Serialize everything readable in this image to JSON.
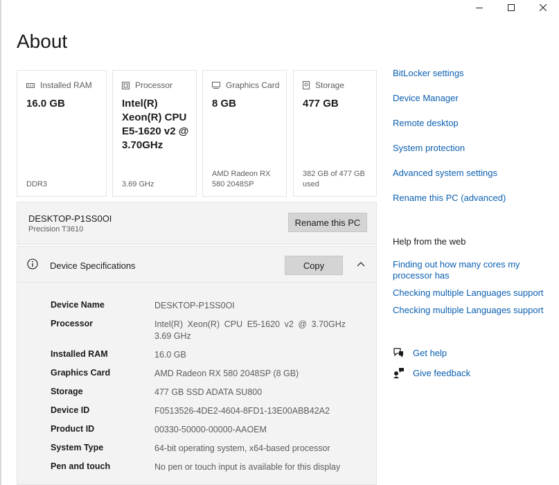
{
  "page": {
    "title": "About"
  },
  "window_controls": {
    "minimize_icon": "minimize-icon",
    "maximize_icon": "maximize-icon",
    "close_icon": "close-icon"
  },
  "cards": [
    {
      "label": "Installed RAM",
      "icon": "ram-icon",
      "value": "16.0 GB",
      "sub": "DDR3"
    },
    {
      "label": "Processor",
      "icon": "processor-icon",
      "value": "Intel(R) Xeon(R) CPU E5-1620 v2 @ 3.70GHz",
      "sub": "3.69 GHz"
    },
    {
      "label": "Graphics Card",
      "icon": "graphics-card-icon",
      "value": "8 GB",
      "sub": "AMD Radeon RX 580 2048SP"
    },
    {
      "label": "Storage",
      "icon": "storage-icon",
      "value": "477 GB",
      "sub": "382 GB of 477 GB used"
    }
  ],
  "pc": {
    "name": "DESKTOP-P1SS0OI",
    "model": "Precision T3610",
    "rename_label": "Rename this PC"
  },
  "device_specs": {
    "title": "Device Specifications",
    "copy_label": "Copy",
    "rows": [
      {
        "key": "Device Name",
        "value": "DESKTOP-P1SS0OI"
      },
      {
        "key": "Processor",
        "value": "Intel(R) Xeon(R) CPU E5-1620 v2 @ 3.70GHz 3.69 GHz"
      },
      {
        "key": "Installed RAM",
        "value": "16.0 GB"
      },
      {
        "key": "Graphics Card",
        "value": "AMD Radeon RX 580 2048SP (8 GB)"
      },
      {
        "key": "Storage",
        "value": "477 GB SSD ADATA SU800"
      },
      {
        "key": "Device ID",
        "value": "F0513526-4DE2-4604-8FD1-13E00ABB42A2"
      },
      {
        "key": "Product ID",
        "value": "00330-50000-00000-AAOEM"
      },
      {
        "key": "System Type",
        "value": "64-bit operating system, x64-based processor"
      },
      {
        "key": "Pen and touch",
        "value": "No pen or touch input is available for this display"
      }
    ]
  },
  "related_links": [
    "BitLocker settings",
    "Device Manager",
    "Remote desktop",
    "System protection",
    "Advanced system settings",
    "Rename this PC (advanced)"
  ],
  "help": {
    "title": "Help from the web",
    "links": [
      "Finding out how many cores my processor has",
      "Checking multiple Languages support",
      "Checking multiple Languages support"
    ]
  },
  "actions": [
    {
      "label": "Get help",
      "icon": "get-help-icon"
    },
    {
      "label": "Give feedback",
      "icon": "feedback-icon"
    }
  ],
  "colors": {
    "link": "#0b5fb0",
    "panel": "#f3f3f3",
    "button": "#d4d4d4"
  }
}
